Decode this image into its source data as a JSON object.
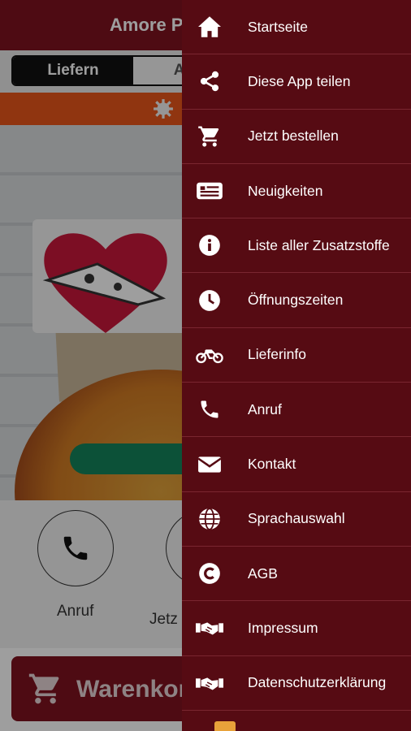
{
  "app": {
    "title": "Amore Pi",
    "order_modes": [
      {
        "label": "Liefern",
        "active": true
      },
      {
        "label": "Abho",
        "active": false
      }
    ],
    "quick_actions": [
      {
        "label": "Anruf",
        "icon": "phone-icon"
      },
      {
        "label": "Jetz",
        "icon": "circle-icon"
      }
    ],
    "cart": {
      "label": "Warenkorl",
      "icon": "cart-icon"
    }
  },
  "drawer": {
    "items": [
      {
        "label": "Startseite",
        "icon": "home-icon"
      },
      {
        "label": "Diese App teilen",
        "icon": "share-icon"
      },
      {
        "label": "Jetzt bestellen",
        "icon": "cart-icon"
      },
      {
        "label": "Neuigkeiten",
        "icon": "news-icon"
      },
      {
        "label": "Liste aller Zusatzstoffe",
        "icon": "info-icon"
      },
      {
        "label": "Öffnungszeiten",
        "icon": "clock-icon"
      },
      {
        "label": "Lieferinfo",
        "icon": "motorcycle-icon"
      },
      {
        "label": "Anruf",
        "icon": "phone-icon"
      },
      {
        "label": "Kontakt",
        "icon": "envelope-icon"
      },
      {
        "label": "Sprachauswahl",
        "icon": "globe-icon"
      },
      {
        "label": "AGB",
        "icon": "copyright-icon"
      },
      {
        "label": "Impressum",
        "icon": "handshake-icon"
      },
      {
        "label": "Datenschutzerklärung",
        "icon": "handshake-icon"
      }
    ]
  },
  "colors": {
    "drawer_bg": "#560b13",
    "header_bg": "#7e1320",
    "promo_bar": "#e8561b",
    "cta_green": "#14845b"
  }
}
